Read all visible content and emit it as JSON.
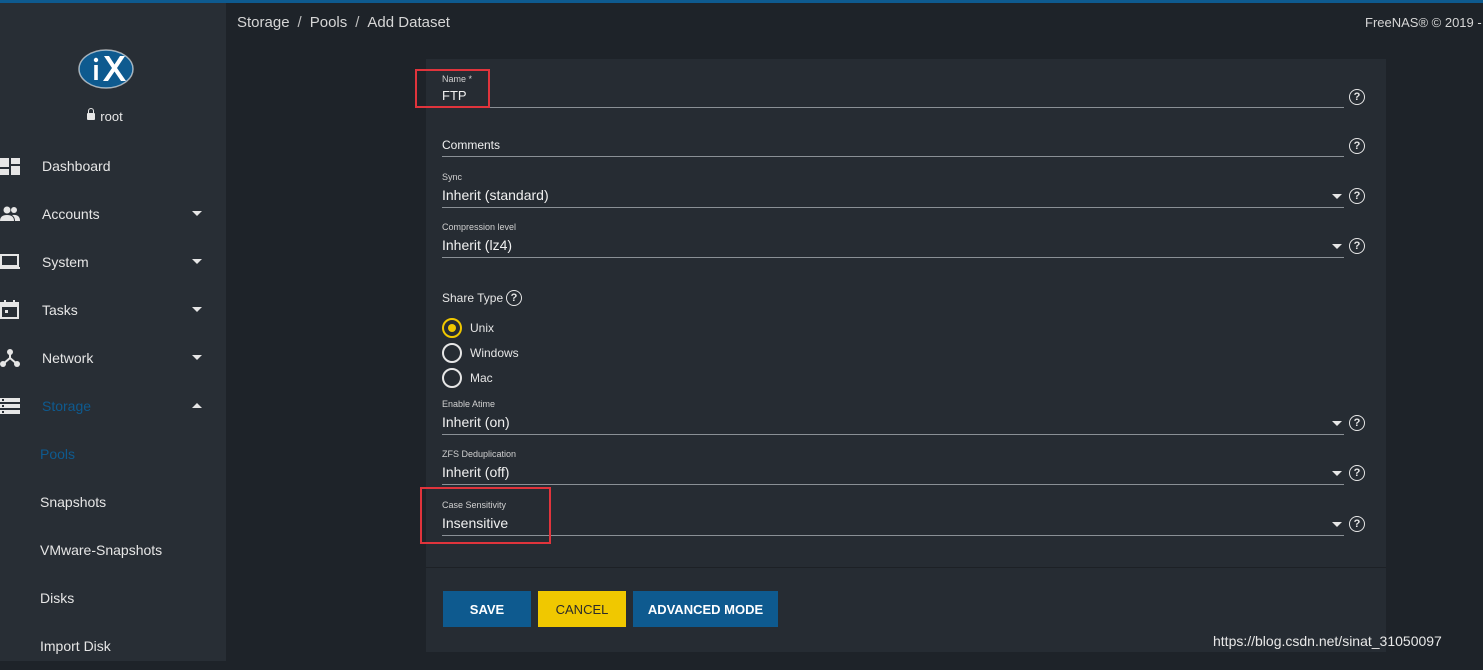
{
  "header": {
    "breadcrumb": [
      "Storage",
      "Pools",
      "Add Dataset"
    ],
    "breadcrumb_sep": "/",
    "copyright": "FreeNAS® © 2019 -"
  },
  "sidebar": {
    "user": "root",
    "items": [
      {
        "label": "Dashboard",
        "icon": "dashboard-icon",
        "caret": ""
      },
      {
        "label": "Accounts",
        "icon": "people-icon",
        "caret": "down"
      },
      {
        "label": "System",
        "icon": "laptop-icon",
        "caret": "down"
      },
      {
        "label": "Tasks",
        "icon": "calendar-icon",
        "caret": "down"
      },
      {
        "label": "Network",
        "icon": "network-icon",
        "caret": "down"
      },
      {
        "label": "Storage",
        "icon": "storage-icon",
        "caret": "up",
        "active": true
      }
    ],
    "subitems": [
      "Pools",
      "Snapshots",
      "VMware-Snapshots",
      "Disks",
      "Import Disk"
    ]
  },
  "form": {
    "name": {
      "label": "Name *",
      "value": "FTP"
    },
    "comments": {
      "label": "Comments"
    },
    "sync": {
      "label": "Sync",
      "value": "Inherit (standard)"
    },
    "compression": {
      "label": "Compression level",
      "value": "Inherit (lz4)"
    },
    "share_type": {
      "label": "Share Type",
      "options": [
        "Unix",
        "Windows",
        "Mac"
      ],
      "selected": "Unix"
    },
    "atime": {
      "label": "Enable Atime",
      "value": "Inherit (on)"
    },
    "dedup": {
      "label": "ZFS Deduplication",
      "value": "Inherit (off)"
    },
    "case": {
      "label": "Case Sensitivity",
      "value": "Insensitive"
    },
    "help_glyph": "?"
  },
  "buttons": {
    "save": "SAVE",
    "cancel": "CANCEL",
    "advanced": "ADVANCED MODE"
  },
  "watermark": "https://blog.csdn.net/sinat_31050097",
  "colors": {
    "accent": "#0e5a8f",
    "cancel": "#f0c800",
    "highlight": "#e0343c"
  }
}
